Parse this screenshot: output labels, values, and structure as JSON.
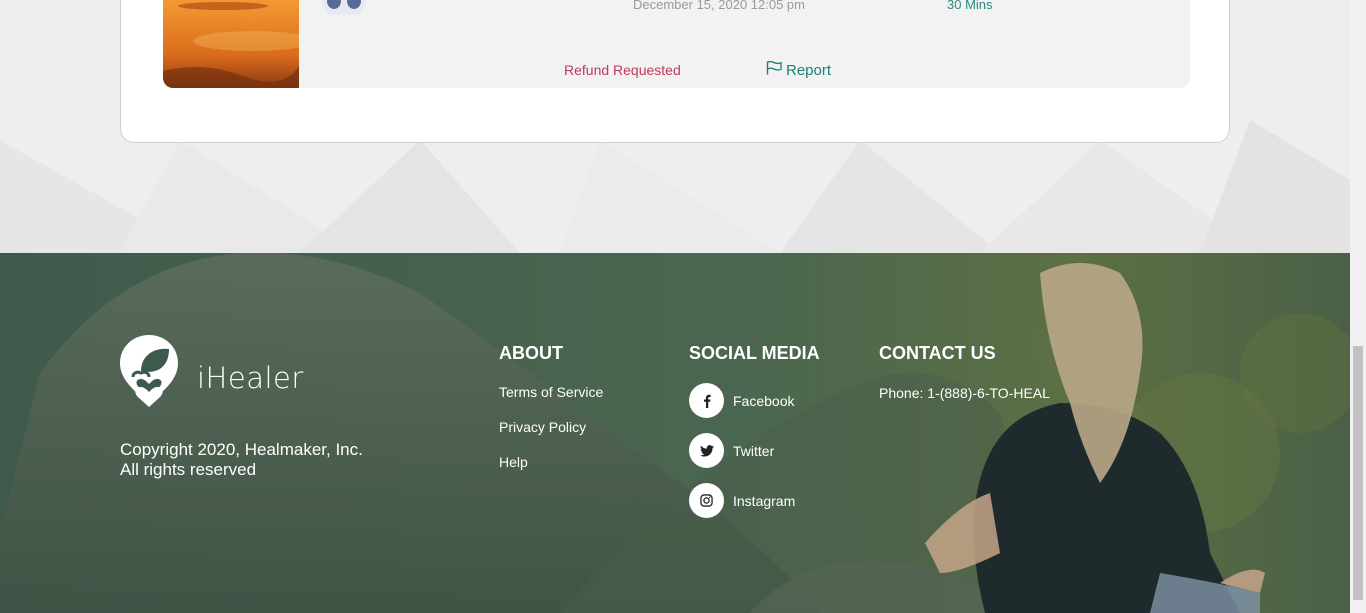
{
  "booking": {
    "date": "December 15, 2020 12:05 pm",
    "duration": "30 Mins",
    "status": "Refund Requested",
    "report_label": "Report"
  },
  "footer": {
    "logo_text": "iHealer",
    "copyright_line1": "Copyright 2020, Healmaker, Inc.",
    "copyright_line2": "All rights reserved",
    "about": {
      "title": "ABOUT",
      "links": [
        "Terms of Service",
        "Privacy Policy",
        "Help"
      ]
    },
    "social": {
      "title": "SOCIAL MEDIA",
      "items": [
        {
          "label": "Facebook",
          "icon": "facebook-icon"
        },
        {
          "label": "Twitter",
          "icon": "twitter-icon"
        },
        {
          "label": "Instagram",
          "icon": "instagram-icon"
        }
      ]
    },
    "contact": {
      "title": "CONTACT US",
      "phone": "Phone: 1-(888)-6-TO-HEAL"
    }
  },
  "colors": {
    "accent_teal": "#1d7f76",
    "refund_red": "#c0395a",
    "footer_overlay": "#3e5a4c"
  }
}
